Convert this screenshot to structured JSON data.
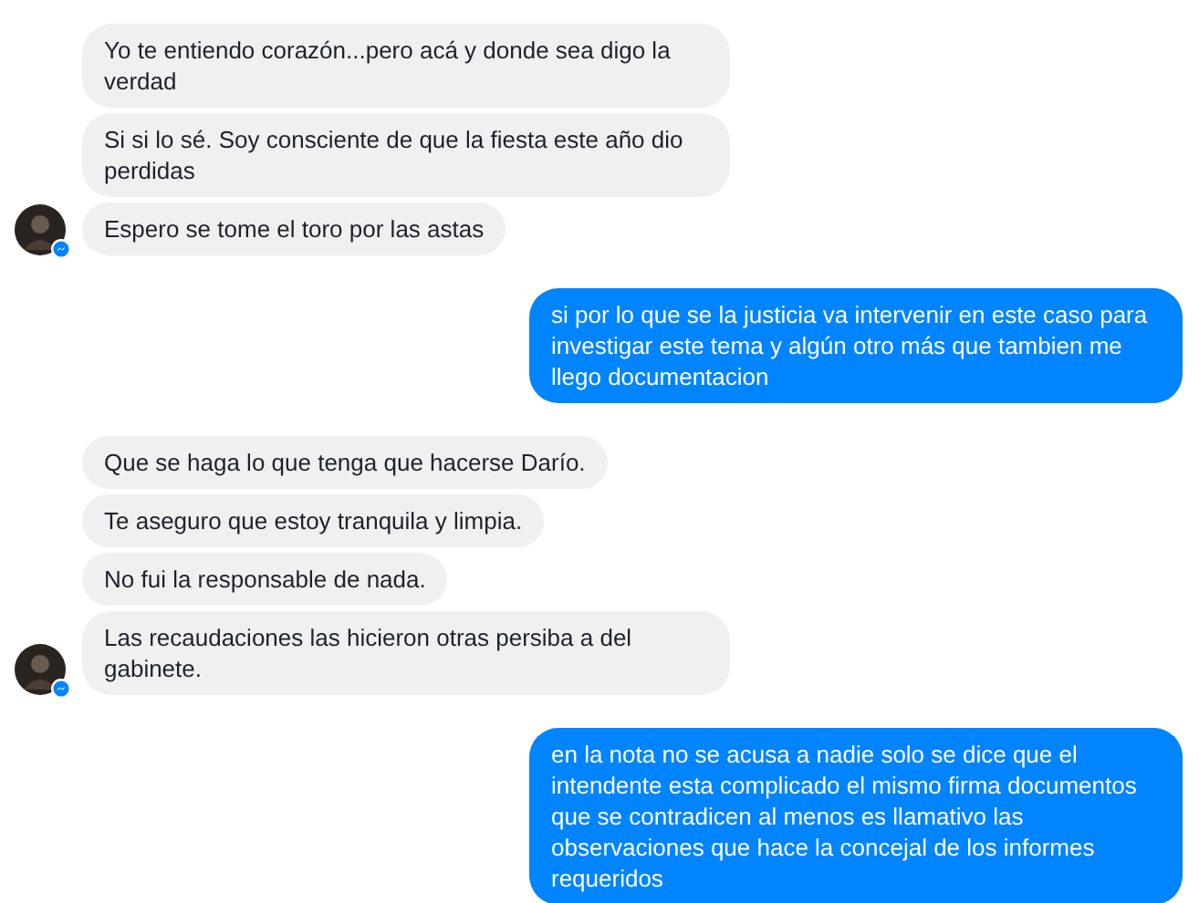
{
  "groups": [
    {
      "kind": "incoming",
      "messages": [
        "Yo te entiendo corazón...pero acá y donde sea digo la verdad",
        "Si si lo sé. Soy consciente de que la fiesta este año dio perdidas",
        "Espero se tome el toro por las astas"
      ]
    },
    {
      "kind": "outgoing",
      "messages": [
        "si por lo que se la justicia va intervenir en este caso para investigar este tema y algún otro más que tambien me llego documentacion"
      ]
    },
    {
      "kind": "incoming",
      "messages": [
        "Que se haga lo que tenga que hacerse Darío.",
        "Te aseguro que estoy tranquila y limpia.",
        "No fui la responsable de nada.",
        "Las recaudaciones las hicieron otras persiba a del gabinete."
      ]
    },
    {
      "kind": "outgoing",
      "messages": [
        "en la nota no se acusa a nadie solo se dice que el intendente esta complicado el mismo firma documentos que se contradicen al menos es llamativo las observaciones que hace la concejal de los informes requeridos"
      ]
    }
  ]
}
